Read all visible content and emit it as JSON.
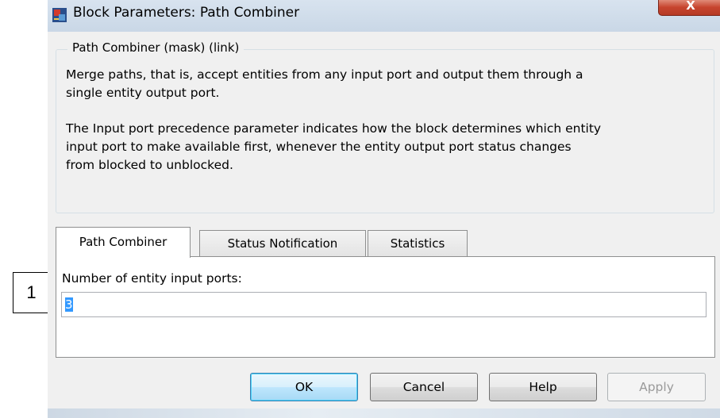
{
  "window": {
    "title": "Block Parameters: Path Combiner",
    "close_label": "X",
    "icon": "simulink-block-icon"
  },
  "description": {
    "legend": "Path Combiner (mask) (link)",
    "paragraph1_line1": "Merge paths, that is, accept entities from any input port and output them through a",
    "paragraph1_line2": "single entity output port.",
    "paragraph2_line1": "The Input port precedence parameter indicates how the block determines which entity",
    "paragraph2_line2": "input port to make available first, whenever the entity output port status changes",
    "paragraph2_line3": "from blocked to unblocked."
  },
  "tabs": [
    {
      "label": "Path Combiner",
      "active": true
    },
    {
      "label": "Status Notification",
      "active": false
    },
    {
      "label": "Statistics",
      "active": false
    }
  ],
  "panel": {
    "ports_label": "Number of entity input ports:",
    "ports_value": "3"
  },
  "buttons": {
    "ok": "OK",
    "cancel": "Cancel",
    "help": "Help",
    "apply": "Apply"
  },
  "callout": {
    "label": "1"
  }
}
